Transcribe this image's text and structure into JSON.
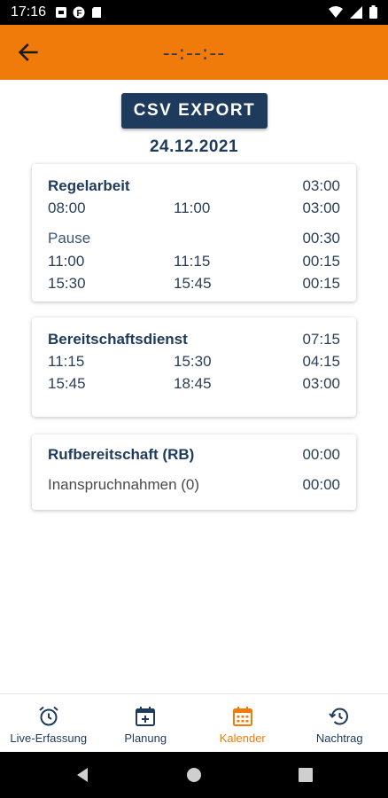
{
  "status_bar": {
    "time": "17:16"
  },
  "app_bar": {
    "title": "--:--:--"
  },
  "export_button": {
    "label": "CSV EXPORT"
  },
  "date": "24.12.2021",
  "regelarbeit": {
    "title": "Regelarbeit",
    "total": "03:00",
    "entries": [
      {
        "start": "08:00",
        "end": "11:00",
        "duration": "03:00"
      }
    ],
    "pause": {
      "title": "Pause",
      "total": "00:30",
      "entries": [
        {
          "start": "11:00",
          "end": "11:15",
          "duration": "00:15"
        },
        {
          "start": "15:30",
          "end": "15:45",
          "duration": "00:15"
        }
      ]
    }
  },
  "bereitschaftsdienst": {
    "title": "Bereitschaftsdienst",
    "total": "07:15",
    "entries": [
      {
        "start": "11:15",
        "end": "15:30",
        "duration": "04:15"
      },
      {
        "start": "15:45",
        "end": "18:45",
        "duration": "03:00"
      }
    ]
  },
  "rufbereitschaft": {
    "title": "Rufbereitschaft (RB)",
    "total": "00:00",
    "claims_label": "Inanspruchnahmen (0)",
    "claims_total": "00:00"
  },
  "bottom_nav": {
    "items": [
      {
        "label": "Live-Erfassung",
        "icon": "alarm-clock-icon"
      },
      {
        "label": "Planung",
        "icon": "calendar-plus-icon"
      },
      {
        "label": "Kalender",
        "icon": "calendar-icon",
        "active": true
      },
      {
        "label": "Nachtrag",
        "icon": "history-icon"
      }
    ]
  },
  "colors": {
    "accent": "#F07A0A",
    "primary": "#1E3A5C"
  }
}
